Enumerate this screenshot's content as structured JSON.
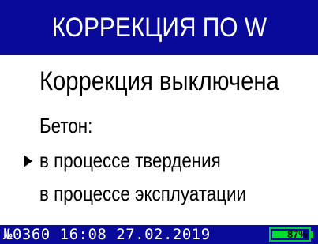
{
  "header": {
    "title": "КОРРЕКЦИЯ ПО W"
  },
  "main": {
    "status": "Коррекция выключена",
    "section_label": "Бетон:",
    "options": [
      {
        "label": "в процессе твердения",
        "selected": true
      },
      {
        "label": "в процессе эксплуатации",
        "selected": false
      }
    ]
  },
  "footer": {
    "info": "№0360 16:08 27.02.2019",
    "battery_label": "87%",
    "battery_level": 0.87
  },
  "colors": {
    "bar_background": "#0a0a9a",
    "battery_fill": "#00dd33",
    "text": "#000000",
    "header_text": "#ffffff"
  },
  "icons": {
    "selector": "selector-arrow-icon",
    "battery": "battery-icon"
  }
}
